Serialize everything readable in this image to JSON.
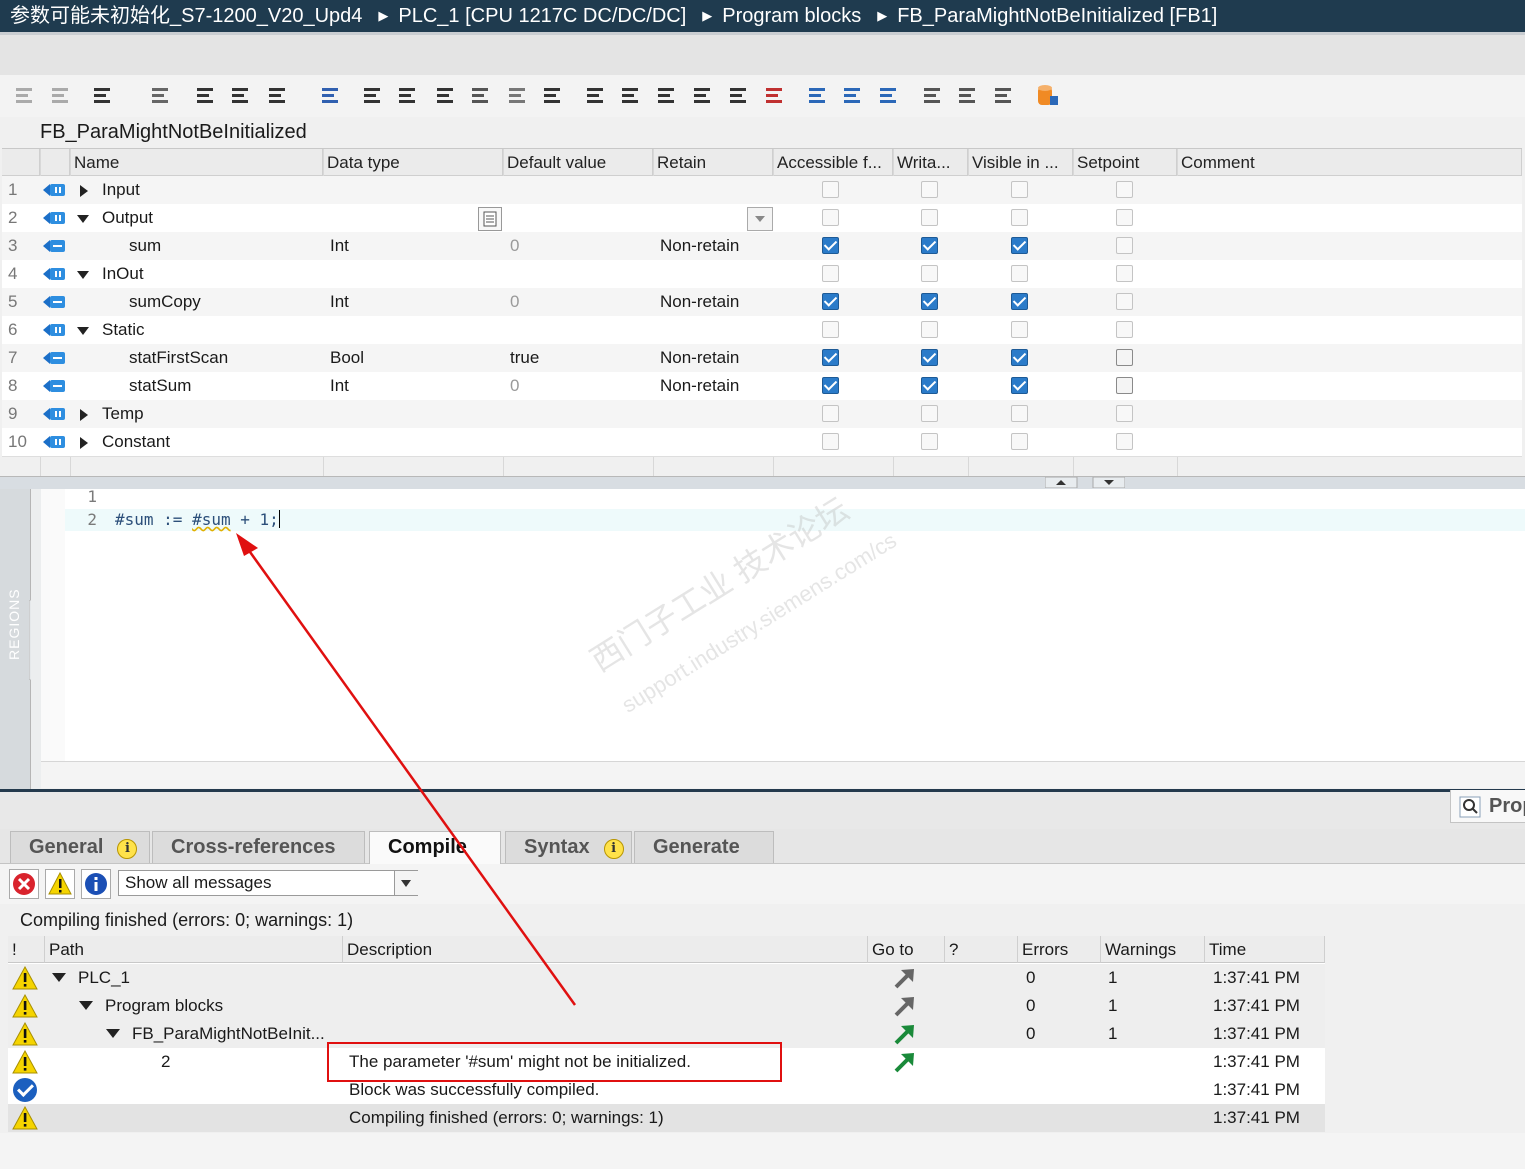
{
  "breadcrumb": [
    "参数可能未初始化_S7-1200_V20_Upd4",
    "PLC_1 [CPU 1217C DC/DC/DC]",
    "Program blocks",
    "FB_ParaMightNotBeInitialized [FB1]"
  ],
  "block_title": "FB_ParaMightNotBeInitialized",
  "interface": {
    "headers": {
      "name": "Name",
      "data_type": "Data type",
      "default_value": "Default value",
      "retain": "Retain",
      "accessible": "Accessible f...",
      "writable": "Writa...",
      "visible": "Visible in ...",
      "setpoint": "Setpoint",
      "comment": "Comment"
    },
    "rows": [
      {
        "num": "1",
        "name": "Input",
        "type": "",
        "default": "",
        "retain": "",
        "expand": "collapsed",
        "acc": false,
        "wr": false,
        "vis": false,
        "set": false
      },
      {
        "num": "2",
        "name": "Output",
        "type": "",
        "default": "",
        "retain": "",
        "expand": "expanded",
        "acc": false,
        "wr": false,
        "vis": false,
        "set": false
      },
      {
        "num": "3",
        "name": "sum",
        "type": "Int",
        "default": "0",
        "retain": "Non-retain",
        "expand": "",
        "acc": true,
        "wr": true,
        "vis": true,
        "set": false
      },
      {
        "num": "4",
        "name": "InOut",
        "type": "",
        "default": "",
        "retain": "",
        "expand": "expanded",
        "acc": false,
        "wr": false,
        "vis": false,
        "set": false
      },
      {
        "num": "5",
        "name": "sumCopy",
        "type": "Int",
        "default": "0",
        "retain": "Non-retain",
        "expand": "",
        "acc": true,
        "wr": true,
        "vis": true,
        "set": false
      },
      {
        "num": "6",
        "name": "Static",
        "type": "",
        "default": "",
        "retain": "",
        "expand": "expanded",
        "acc": false,
        "wr": false,
        "vis": false,
        "set": false
      },
      {
        "num": "7",
        "name": "statFirstScan",
        "type": "Bool",
        "default": "true",
        "retain": "Non-retain",
        "expand": "",
        "acc": true,
        "wr": true,
        "vis": true,
        "set": false
      },
      {
        "num": "8",
        "name": "statSum",
        "type": "Int",
        "default": "0",
        "retain": "Non-retain",
        "expand": "",
        "acc": true,
        "wr": true,
        "vis": true,
        "set": false
      },
      {
        "num": "9",
        "name": "Temp",
        "type": "",
        "default": "",
        "retain": "",
        "expand": "collapsed",
        "acc": false,
        "wr": false,
        "vis": false,
        "set": false
      },
      {
        "num": "10",
        "name": "Constant",
        "type": "",
        "default": "",
        "retain": "",
        "expand": "collapsed",
        "acc": false,
        "wr": false,
        "vis": false,
        "set": false
      }
    ]
  },
  "editor": {
    "regions_label": "REGIONS",
    "lines": [
      {
        "num": "1",
        "code_pre": "",
        "code_var": "",
        "code_post": ""
      },
      {
        "num": "2",
        "code_pre": "#sum := ",
        "code_var": "#sum",
        "code_post": " + 1;"
      }
    ]
  },
  "watermark": {
    "line1": "西门子工业   技术论坛",
    "line2": "support.industry.siemens.com/cs"
  },
  "inspector": {
    "properties_tab": "Prop",
    "tabs": [
      {
        "label": "General",
        "info": true
      },
      {
        "label": "Cross-references",
        "info": false
      },
      {
        "label": "Compile",
        "info": false
      },
      {
        "label": "Syntax",
        "info": true
      },
      {
        "label": "Generate",
        "info": false
      }
    ],
    "info_glyph": "i",
    "filter_value": "Show all messages",
    "status": "Compiling finished (errors: 0; warnings: 1)",
    "messages": {
      "headers": {
        "bang": "!",
        "path": "Path",
        "description": "Description",
        "goto": "Go to",
        "q": "?",
        "errors": "Errors",
        "warnings": "Warnings",
        "time": "Time"
      },
      "rows": [
        {
          "icon": "warning",
          "path": "PLC_1",
          "indent": 0,
          "expand": true,
          "description": "",
          "goto": "gray",
          "errors": "0",
          "warnings": "1",
          "time": "1:37:41 PM"
        },
        {
          "icon": "warning",
          "path": "Program blocks",
          "indent": 1,
          "expand": true,
          "description": "",
          "goto": "gray",
          "errors": "0",
          "warnings": "1",
          "time": "1:37:41 PM"
        },
        {
          "icon": "warning",
          "path": "FB_ParaMightNotBeInit...",
          "indent": 2,
          "expand": true,
          "description": "",
          "goto": "green",
          "errors": "0",
          "warnings": "1",
          "time": "1:37:41 PM"
        },
        {
          "icon": "warning",
          "path": "2",
          "indent": 3,
          "expand": false,
          "description": "The parameter '#sum' might not be initialized.",
          "goto": "green",
          "errors": "",
          "warnings": "",
          "time": "1:37:41 PM"
        },
        {
          "icon": "ok",
          "path": "",
          "indent": 0,
          "expand": false,
          "description": "Block was successfully compiled.",
          "goto": "",
          "errors": "",
          "warnings": "",
          "time": "1:37:41 PM"
        },
        {
          "icon": "warning",
          "path": "",
          "indent": 0,
          "expand": false,
          "description": "Compiling finished (errors: 0; warnings: 1)",
          "goto": "",
          "errors": "",
          "warnings": "",
          "time": "1:37:41 PM"
        }
      ]
    }
  },
  "colors": {
    "title_bg": "#1f3b4f",
    "checkbox_on": "#2b7bc9",
    "annotation_red": "#e01010",
    "warning_yellow": "#f5d400",
    "ok_blue": "#1b5fbf",
    "goto_green": "#1a8a3a"
  }
}
